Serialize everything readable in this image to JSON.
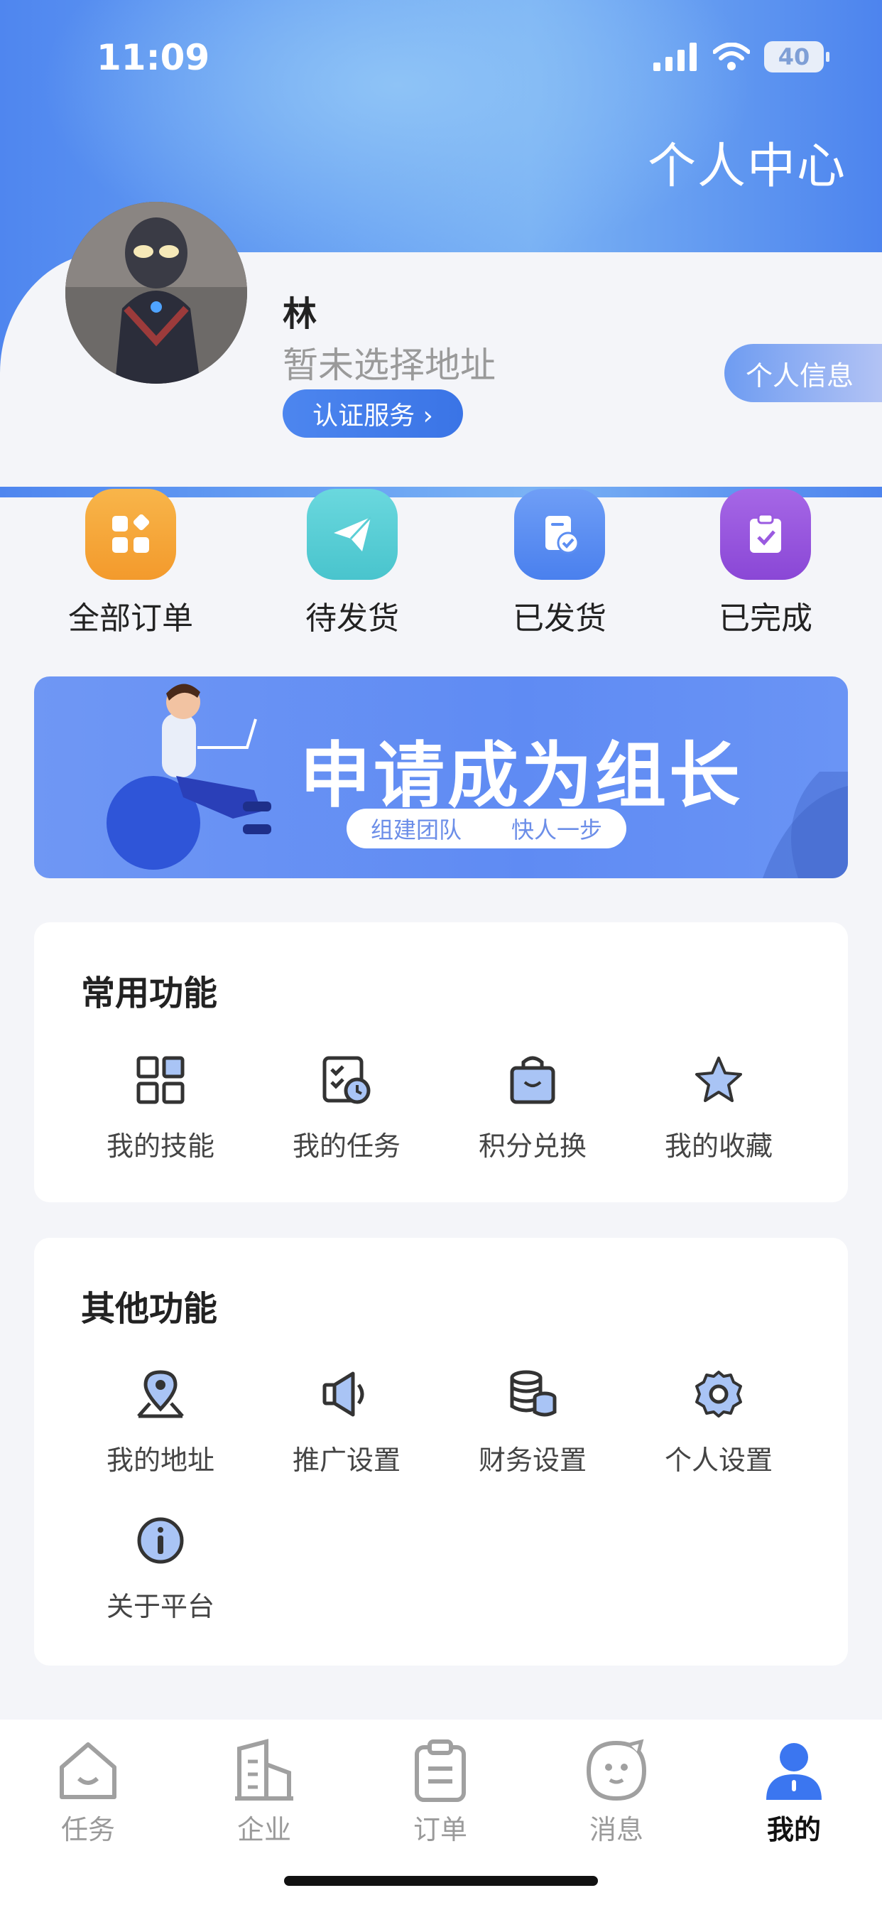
{
  "status_bar": {
    "time": "11:09",
    "battery": "40"
  },
  "header": {
    "title": "个人中心"
  },
  "profile": {
    "name": "林",
    "address": "暂未选择地址",
    "cert_button": "认证服务 ›",
    "info_button": "个人信息"
  },
  "orders": [
    {
      "label": "全部订单",
      "icon": "grid-icon",
      "color": "#f5a43a"
    },
    {
      "label": "待发货",
      "icon": "paper-plane-icon",
      "color": "#5bcfd6"
    },
    {
      "label": "已发货",
      "icon": "document-check-icon",
      "color": "#5c8ef2"
    },
    {
      "label": "已完成",
      "icon": "clipboard-check-icon",
      "color": "#9a5ae0"
    }
  ],
  "banner": {
    "title": "申请成为组长",
    "tag_left": "组建团队",
    "tag_right": "快人一步"
  },
  "common_functions": {
    "title": "常用功能",
    "items": [
      {
        "label": "我的技能",
        "icon": "skills-grid-icon"
      },
      {
        "label": "我的任务",
        "icon": "task-clock-icon"
      },
      {
        "label": "积分兑换",
        "icon": "shopping-bag-icon"
      },
      {
        "label": "我的收藏",
        "icon": "star-icon"
      }
    ]
  },
  "other_functions": {
    "title": "其他功能",
    "items": [
      {
        "label": "我的地址",
        "icon": "location-pin-icon"
      },
      {
        "label": "推广设置",
        "icon": "speaker-icon"
      },
      {
        "label": "财务设置",
        "icon": "coins-icon"
      },
      {
        "label": "个人设置",
        "icon": "gear-icon"
      },
      {
        "label": "关于平台",
        "icon": "info-icon"
      }
    ]
  },
  "tabbar": {
    "items": [
      {
        "label": "任务",
        "icon": "home-smile-icon"
      },
      {
        "label": "企业",
        "icon": "building-icon"
      },
      {
        "label": "订单",
        "icon": "clipboard-icon"
      },
      {
        "label": "消息",
        "icon": "chat-bubble-icon"
      },
      {
        "label": "我的",
        "icon": "person-icon",
        "active": true
      }
    ]
  },
  "colors": {
    "accent": "#3a74e6",
    "active_tab": "#3b76f0"
  }
}
